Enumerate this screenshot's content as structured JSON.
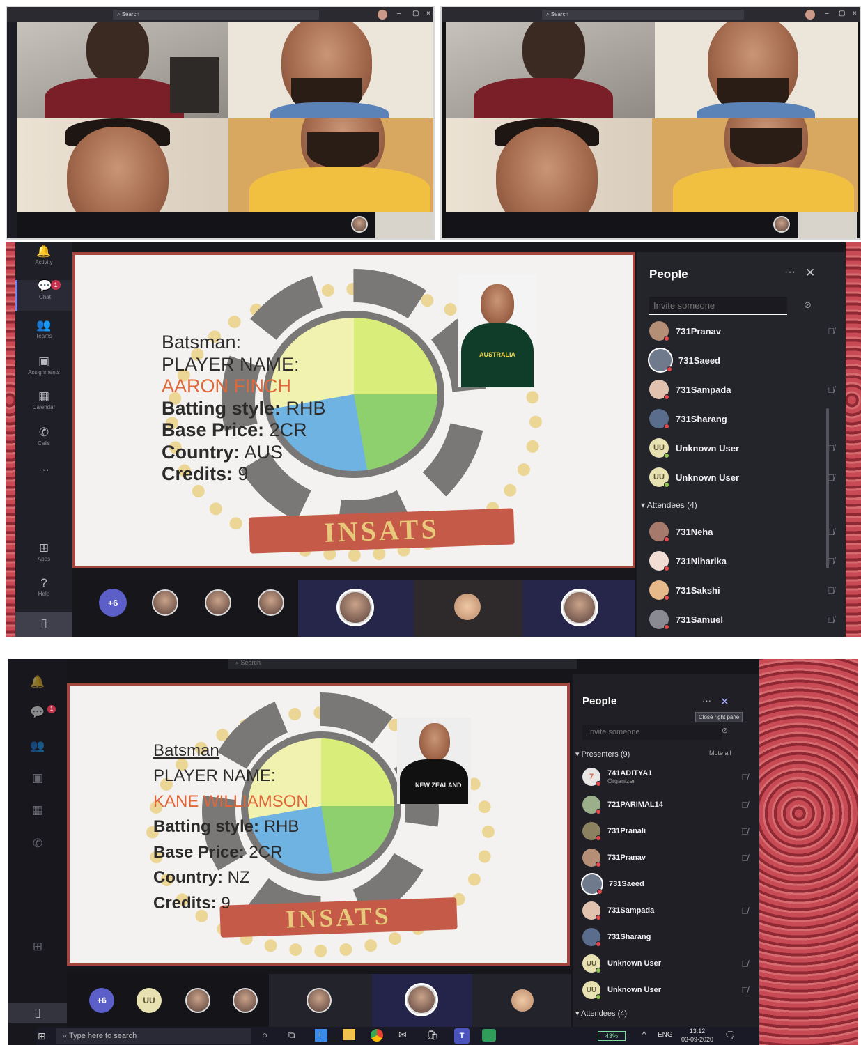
{
  "top_left": {
    "search_label": "Search",
    "window_controls": [
      "–",
      "▢",
      "×"
    ]
  },
  "top_right": {
    "search_label": "Search",
    "window_controls": [
      "–",
      "▢",
      "×"
    ]
  },
  "mid": {
    "rail": [
      "Activity",
      "Chat",
      "Teams",
      "Assignments",
      "Calendar",
      "Calls",
      "···",
      "Apps",
      "Help"
    ],
    "chat_badge": "1",
    "slide": {
      "role": "Batsman:",
      "name_label": "PLAYER NAME:",
      "player": "AARON FINCH",
      "style_label": "Batting style:",
      "style_value": "RHB",
      "price_label": "Base Price:",
      "price_value": "2CR",
      "country_label": "Country:",
      "country_value": "AUS",
      "credits_label": "Credits:",
      "credits_value": "9",
      "banner": "INSATS",
      "jersey": "AUSTRALIA"
    },
    "people": {
      "title": "People",
      "invite_placeholder": "Invite someone",
      "presenters": [
        {
          "name": "731Pranav",
          "avatar": "photo"
        },
        {
          "name": "731Saeed",
          "avatar": "photo"
        },
        {
          "name": "731Sampada",
          "avatar": "photo"
        },
        {
          "name": "731Sharang",
          "avatar": "photo"
        },
        {
          "name": "Unknown User",
          "avatar": "UU"
        },
        {
          "name": "Unknown User",
          "avatar": "UU"
        }
      ],
      "attendees_header": "Attendees (4)",
      "attendees": [
        {
          "name": "731Neha"
        },
        {
          "name": "731Niharika"
        },
        {
          "name": "731Sakshi"
        },
        {
          "name": "731Samuel"
        }
      ]
    },
    "strip_count": "+6"
  },
  "bot": {
    "search_label": "Search",
    "chat_badge": "1",
    "slide": {
      "role": "Batsman",
      "name_label": "PLAYER NAME:",
      "player": "KANE WILLIAMSON",
      "style_label": "Batting style:",
      "style_value": "RHB",
      "price_label": "Base Price:",
      "price_value": "2CR",
      "country_label": "Country:",
      "country_value": "NZ",
      "credits_label": "Credits:",
      "credits_value": "9",
      "banner": "INSATS",
      "jersey": "NEW ZEALAND"
    },
    "people": {
      "title": "People",
      "tooltip": "Close right pane",
      "invite_placeholder": "Invite someone",
      "presenters_header": "Presenters (9)",
      "mute_all": "Mute all",
      "presenters": [
        {
          "name": "741ADITYA1",
          "sub": "Organizer",
          "avatar": "7"
        },
        {
          "name": "721PARIMAL14",
          "avatar": "photo"
        },
        {
          "name": "731Pranali",
          "avatar": "photo"
        },
        {
          "name": "731Pranav",
          "avatar": "photo"
        },
        {
          "name": "731Saeed",
          "avatar": "photo"
        },
        {
          "name": "731Sampada",
          "avatar": "photo"
        },
        {
          "name": "731Sharang",
          "avatar": "photo"
        },
        {
          "name": "Unknown User",
          "avatar": "UU"
        },
        {
          "name": "Unknown User",
          "avatar": "UU"
        }
      ],
      "attendees_header": "Attendees (4)"
    },
    "strip_count": "+6",
    "strip_uu": "UU",
    "taskbar": {
      "search_placeholder": "Type here to search",
      "battery": "43%",
      "lang": "ENG",
      "time": "13:12",
      "date": "03-09-2020"
    }
  }
}
